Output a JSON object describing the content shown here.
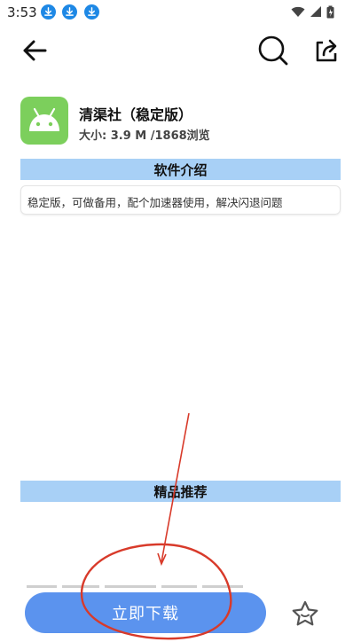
{
  "status_bar": {
    "time": "3:53"
  },
  "app": {
    "name": "清渠社（稳定版）",
    "meta": "大小: 3.9 M /1868浏览"
  },
  "sections": {
    "intro_title": "软件介绍",
    "intro_text": "稳定版，可做备用，配个加速器使用，解决闪退问题",
    "recommend_title": "精品推荐"
  },
  "actions": {
    "download_label": "立即下载"
  },
  "colors": {
    "section_bg": "#a8d0f6",
    "button_bg": "#5b93ee",
    "app_icon_bg": "#7ccf5c",
    "annotation_red": "#d83a2a"
  },
  "icons": {
    "back": "arrow-left-icon",
    "search": "search-icon",
    "share": "share-icon",
    "favorite": "star-icon",
    "download_notifications": "download-icon"
  }
}
